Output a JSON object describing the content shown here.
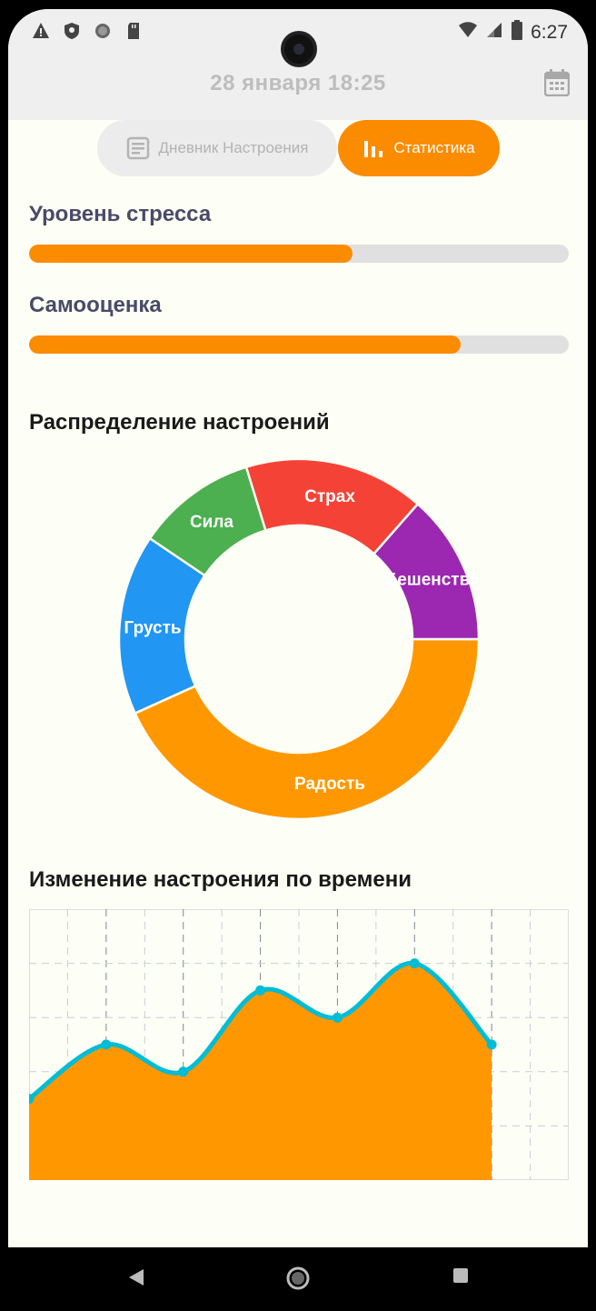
{
  "status_bar": {
    "time": "6:27",
    "left_icons": [
      "warning-icon",
      "shield-icon",
      "circle-icon",
      "sd-card-icon"
    ],
    "right_icons": [
      "wifi-icon",
      "signal-icon",
      "battery-icon"
    ]
  },
  "header": {
    "date": "28 января 18:25",
    "calendar_icon": "calendar-icon"
  },
  "tabs": [
    {
      "label": "Дневник Настроения",
      "icon": "notes-icon",
      "active": false
    },
    {
      "label": "Статистика",
      "icon": "bar-chart-icon",
      "active": true
    }
  ],
  "stress": {
    "title": "Уровень стресса",
    "level": 0.6
  },
  "self_esteem": {
    "title": "Самооценка",
    "level": 0.8
  },
  "colors": {
    "accent": "#fb8c00",
    "line": "#00bcd4",
    "track": "#e0e0e0"
  },
  "distribution": {
    "title": "Распределение настроений"
  },
  "timeline": {
    "title": "Изменение настроения по времени"
  },
  "chart_data": [
    {
      "type": "pie",
      "title": "Распределение настроений",
      "donut": true,
      "slices": [
        {
          "label": "Радость",
          "value": 40,
          "color": "#ff9800"
        },
        {
          "label": "Грусть",
          "value": 15,
          "color": "#2196f3"
        },
        {
          "label": "Сила",
          "value": 10,
          "color": "#4caf50"
        },
        {
          "label": "Страх",
          "value": 15,
          "color": "#f44336"
        },
        {
          "label": "Бешенство",
          "value": 12.5,
          "color": "#9c27b0"
        }
      ]
    },
    {
      "type": "area",
      "title": "Изменение настроения по времени",
      "x": [
        0,
        1,
        2,
        3,
        4,
        5,
        6
      ],
      "y": [
        3,
        5,
        4,
        7,
        6,
        8,
        5
      ],
      "xlim": [
        0,
        7
      ],
      "ylim": [
        0,
        10
      ],
      "grid": true,
      "fill_color": "#ff9800",
      "line_color": "#00bcd4"
    }
  ],
  "nav": {
    "back_icon": "back-triangle-icon",
    "home_icon": "home-circle-icon",
    "recents_icon": "recents-square-icon"
  }
}
